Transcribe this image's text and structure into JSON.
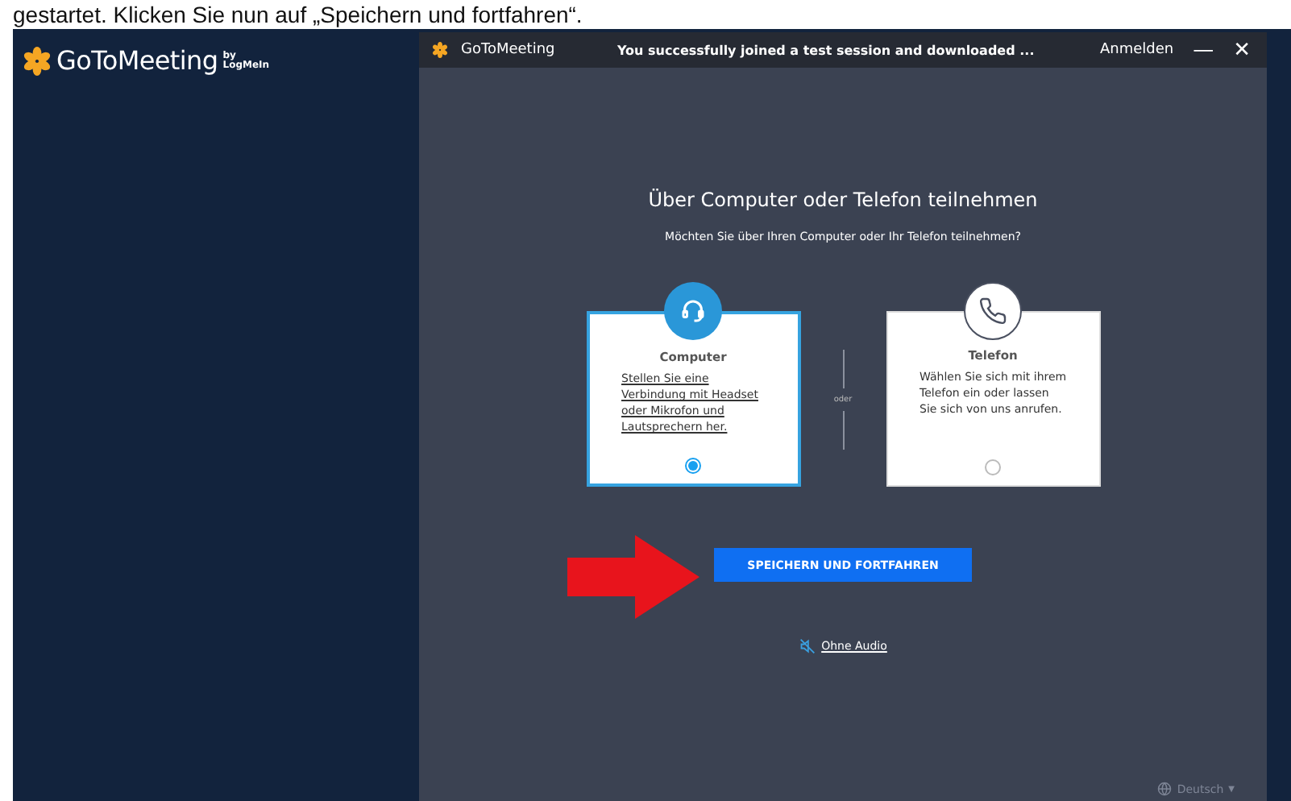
{
  "caption": "gestartet. Klicken Sie nun auf „Speichern und fortfahren“.",
  "brand": {
    "logo": "GoToMeeting",
    "byline_top": "by",
    "byline_bottom": "LogMeIn"
  },
  "window": {
    "logo": "GoToMeeting",
    "title": "You successfully joined a test session and downloaded ...",
    "signin": "Anmelden",
    "minimize": "—",
    "close": "✕"
  },
  "dialog": {
    "heading": "Über Computer oder Telefon teilnehmen",
    "question": "Möchten Sie über Ihren Computer oder Ihr Telefon teilnehmen?",
    "separator": "oder",
    "options": [
      {
        "kind": "computer",
        "title": "Computer",
        "text": "Stellen Sie eine Verbindung mit Headset oder Mikrofon und Lautsprechern her.",
        "selected": true
      },
      {
        "kind": "phone",
        "title": "Telefon",
        "text": "Wählen Sie sich mit ihrem Telefon ein oder lassen Sie sich von uns anrufen.",
        "selected": false
      }
    ],
    "primary_button": "SPEICHERN UND FORTFAHREN",
    "no_audio_link": "Ohne Audio",
    "language": "Deutsch",
    "language_caret": "▼"
  }
}
